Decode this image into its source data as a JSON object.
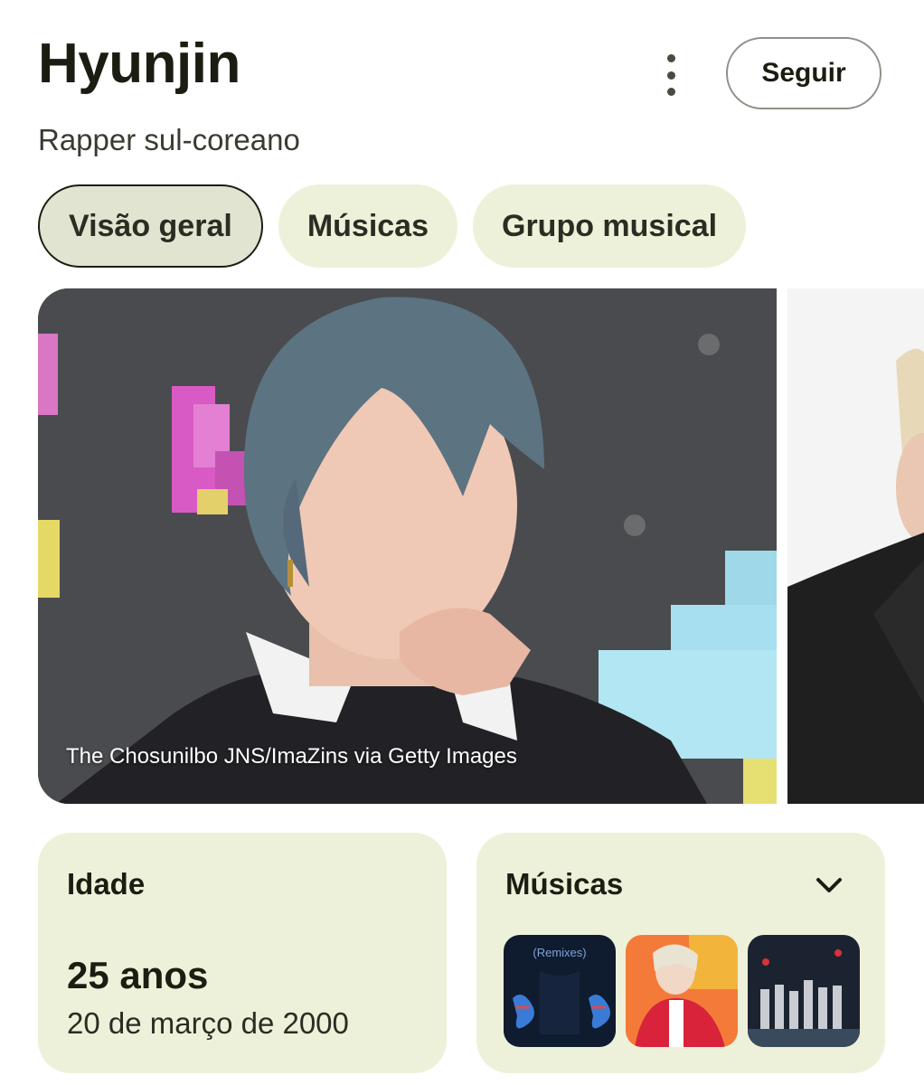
{
  "header": {
    "title": "Hyunjin",
    "subtitle": "Rapper sul-coreano",
    "follow_label": "Seguir"
  },
  "tabs": [
    {
      "label": "Visão geral",
      "active": true
    },
    {
      "label": "Músicas",
      "active": false
    },
    {
      "label": "Grupo musical",
      "active": false
    }
  ],
  "media": {
    "main_caption": "The Chosunilbo JNS/ImaZins via Getty Images"
  },
  "cards": {
    "age": {
      "label": "Idade",
      "value": "25 anos",
      "date": "20 de março de 2000"
    },
    "songs": {
      "label": "Músicas",
      "thumb_texts": [
        "(Remixes)"
      ]
    }
  },
  "colors": {
    "chip_bg": "#eef1d9",
    "chip_active_bg": "#e1e4d0",
    "text_primary": "#1c1d12",
    "card_bg": "#eef1d9"
  },
  "icons": [
    "more-vert-icon",
    "chevron-down-icon"
  ]
}
